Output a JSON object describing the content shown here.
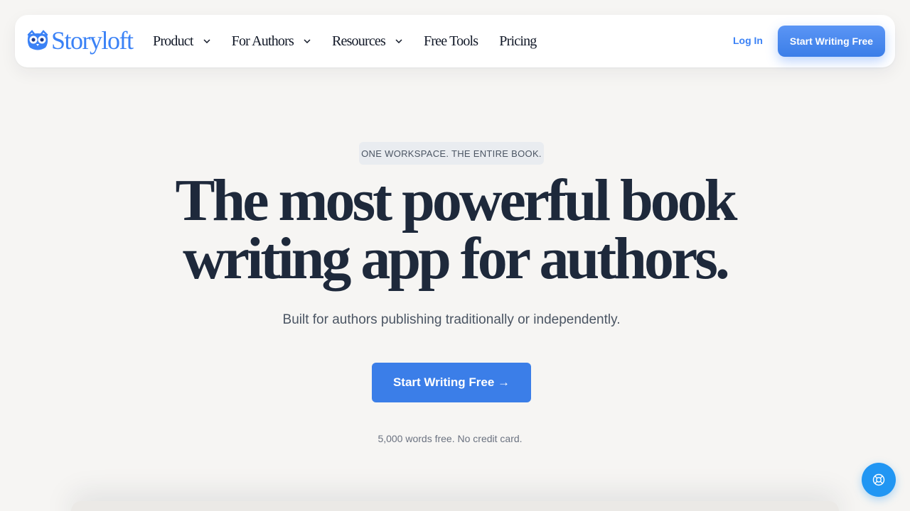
{
  "nav": {
    "logo_text": "Storyloft",
    "logo_icon": "owl-icon",
    "items": [
      {
        "label": "Product",
        "has_dropdown": true
      },
      {
        "label": "For Authors",
        "has_dropdown": true
      },
      {
        "label": "Resources",
        "has_dropdown": true
      },
      {
        "label": "Free Tools",
        "has_dropdown": false
      },
      {
        "label": "Pricing",
        "has_dropdown": false
      }
    ],
    "login_label": "Log In",
    "cta_label": "Start Writing Free"
  },
  "hero": {
    "eyebrow": "ONE WORKSPACE. THE ENTIRE BOOK.",
    "headline_line1": "The most powerful book",
    "headline_line2": "writing app for authors.",
    "subhead": "Built for authors publishing traditionally or independently.",
    "cta_label": "Start Writing Free →",
    "fine_print": "5,000 words free. No credit card."
  },
  "help_icon": "lifebuoy-icon",
  "colors": {
    "brand": "#3b82f6",
    "button": "#3b7ee8",
    "help": "#2196f3",
    "background": "#f6f5f3",
    "text": "#1e293b"
  }
}
